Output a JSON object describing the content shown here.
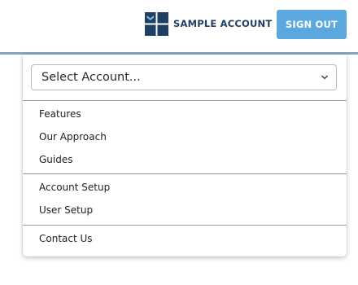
{
  "header": {
    "account_name": "SAMPLE ACCOUNT",
    "sign_out_label": "SIGN OUT",
    "logo_icon": "account-shield-logo-icon",
    "colors": {
      "accent": "#5aa8dd",
      "brand_navy": "#1f3f63",
      "header_border": "#7fa4c4"
    }
  },
  "menu": {
    "select": {
      "value": "Select Account...",
      "icon": "chevron-down-icon"
    },
    "groups": [
      [
        "Features",
        "Our Approach",
        "Guides"
      ],
      [
        "Account Setup",
        "User Setup"
      ],
      [
        "Contact Us"
      ]
    ]
  }
}
